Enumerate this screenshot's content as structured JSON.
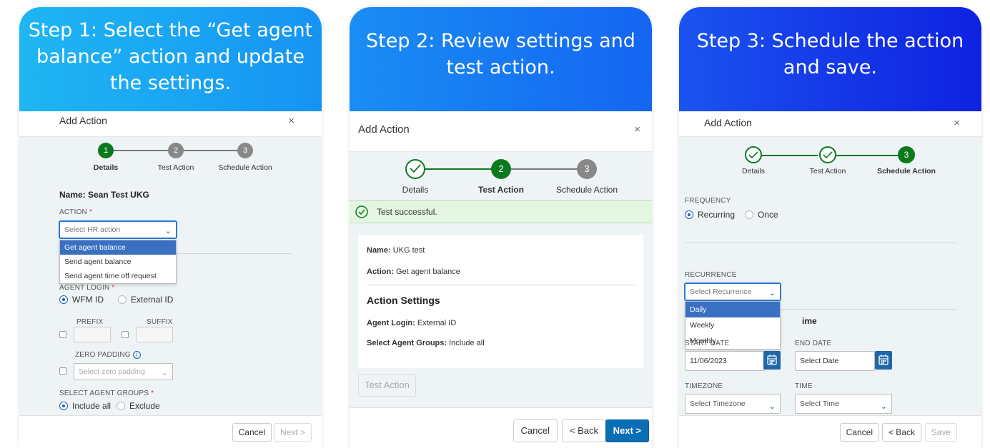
{
  "cards": [
    {
      "hero_title": "Step 1: Select the “Get agent balance” action and update the settings.",
      "dialog_title": "Add Action",
      "close": "×",
      "steps": [
        {
          "num": "1",
          "label": "Details"
        },
        {
          "num": "2",
          "label": "Test Action"
        },
        {
          "num": "3",
          "label": "Schedule Action"
        }
      ],
      "name_line": "Name: Sean Test UKG",
      "action_label": "ACTION",
      "required_mark": "*",
      "action_placeholder": "Select HR action",
      "action_options": [
        "Get agent balance",
        "Send agent balance",
        "Send agent time off request"
      ],
      "agent_login_label": "AGENT LOGIN",
      "login_options": [
        "WFM ID",
        "External ID"
      ],
      "prefix_label": "PREFIX",
      "suffix_label": "SUFFIX",
      "zero_padding_label": "ZERO PADDING",
      "zero_padding_placeholder": "Select zero padding",
      "agent_groups_label": "SELECT AGENT GROUPS",
      "group_options": [
        "Include all",
        "Exclude"
      ],
      "cancel": "Cancel",
      "next": "Next >"
    },
    {
      "hero_title": "Step 2: Review settings and test action.",
      "dialog_title": "Add Action",
      "close": "×",
      "steps": [
        {
          "num": "",
          "label": "Details"
        },
        {
          "num": "2",
          "label": "Test Action"
        },
        {
          "num": "3",
          "label": "Schedule Action"
        }
      ],
      "success_msg": "Test successful.",
      "name_key": "Name:",
      "name_val": "UKG test",
      "action_key": "Action:",
      "action_val": "Get agent balance",
      "settings_heading": "Action Settings",
      "login_key": "Agent Login:",
      "login_val": "External ID",
      "groups_key": "Select Agent Groups:",
      "groups_val": "Include all",
      "test_button": "Test Action",
      "cancel": "Cancel",
      "back": "< Back",
      "next": "Next >"
    },
    {
      "hero_title": "Step 3: Schedule the action and save.",
      "dialog_title": "Add Action",
      "close": "×",
      "steps": [
        {
          "num": "",
          "label": "Details"
        },
        {
          "num": "",
          "label": "Test Action"
        },
        {
          "num": "3",
          "label": "Schedule Action"
        }
      ],
      "frequency_label": "FREQUENCY",
      "frequency_options": [
        "Recurring",
        "Once"
      ],
      "recurrence_label": "RECURRENCE",
      "recurrence_placeholder": "Select Recurrence",
      "recurrence_options": [
        "Daily",
        "Weekly",
        "Monthly"
      ],
      "hidden_heading_tail": "ime",
      "start_date_label": "START DATE",
      "start_date_value": "11/06/2023",
      "end_date_label": "END DATE",
      "end_date_placeholder": "Select Date",
      "timezone_label": "TIMEZONE",
      "timezone_placeholder": "Select Timezone",
      "time_label": "TIME",
      "time_placeholder": "Select Time",
      "cancel": "Cancel",
      "back": "< Back",
      "save": "Save"
    }
  ],
  "colors": {
    "active_step": "#0b7a1e",
    "primary_button": "#0a6eb4",
    "dropdown_selected": "#3a70c2",
    "success_bg": "#e4f5e2"
  }
}
